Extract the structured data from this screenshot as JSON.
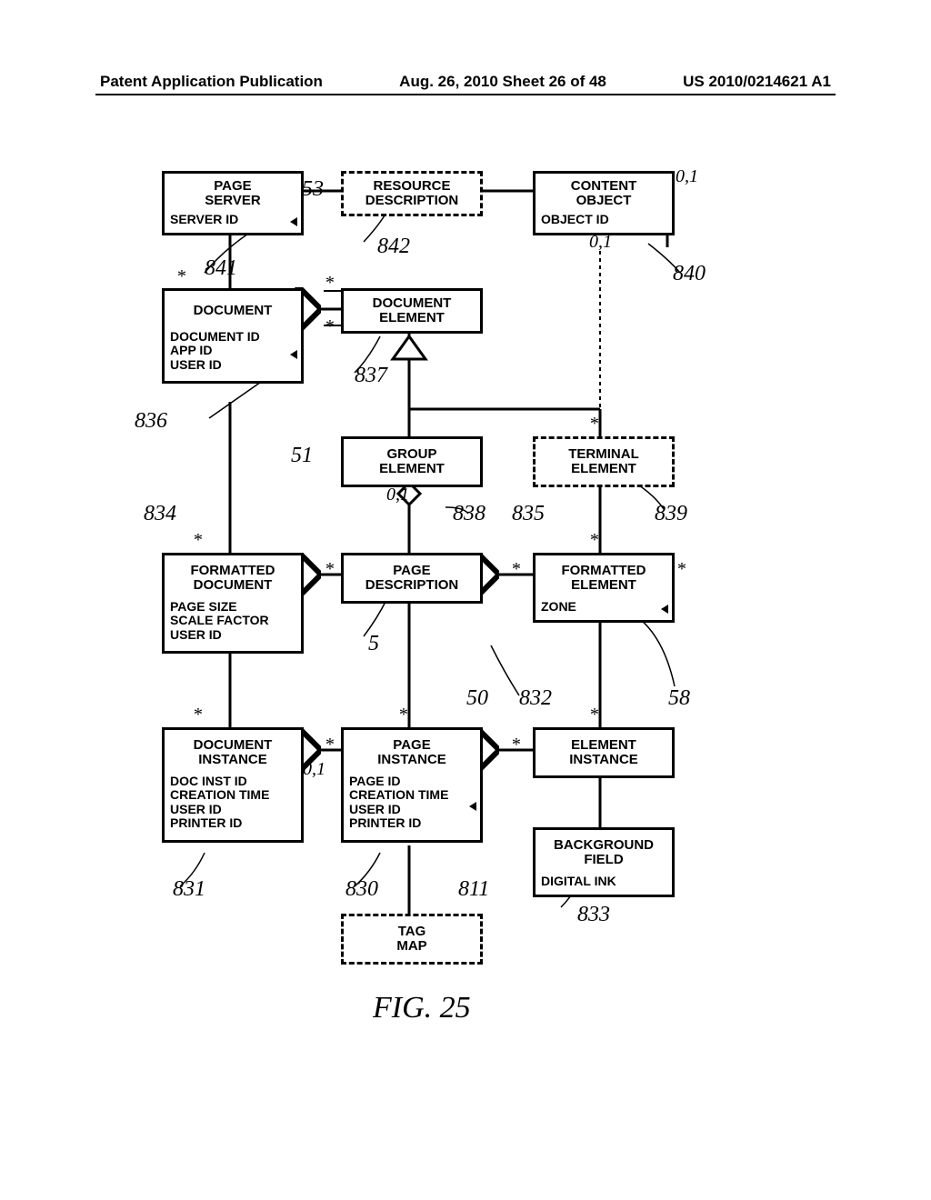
{
  "header": {
    "left": "Patent Application Publication",
    "center": "Aug. 26, 2010  Sheet 26 of 48",
    "right": "US 2010/0214621 A1"
  },
  "boxes": {
    "page_server": "PAGE\nSERVER",
    "page_server_attr": "SERVER ID",
    "resource_desc": "RESOURCE\nDESCRIPTION",
    "content_obj": "CONTENT\nOBJECT",
    "content_obj_attr": "OBJECT ID",
    "document": "DOCUMENT",
    "document_attr": "DOCUMENT ID\nAPP ID\nUSER ID",
    "document_element": "DOCUMENT\nELEMENT",
    "group_element": "GROUP\nELEMENT",
    "terminal_element": "TERMINAL\nELEMENT",
    "formatted_document": "FORMATTED\nDOCUMENT",
    "formatted_document_attr": "PAGE SIZE\nSCALE FACTOR\nUSER ID",
    "page_description": "PAGE\nDESCRIPTION",
    "formatted_element": "FORMATTED\nELEMENT",
    "formatted_element_attr": "ZONE",
    "document_instance": "DOCUMENT\nINSTANCE",
    "document_instance_attr": "DOC INST ID\nCREATION TIME\nUSER ID\nPRINTER ID",
    "page_instance": "PAGE\nINSTANCE",
    "page_instance_attr": "PAGE ID\nCREATION TIME\nUSER ID\nPRINTER ID",
    "element_instance": "ELEMENT\nINSTANCE",
    "background_field": "BACKGROUND\nFIELD",
    "background_field_attr": "DIGITAL INK",
    "tag_map": "TAG\nMAP"
  },
  "refs": {
    "r53": "53",
    "r842": "842",
    "r841": "841",
    "r840": "840",
    "r837": "837",
    "r836": "836",
    "r51": "51",
    "r838": "838",
    "r835": "835",
    "r839": "839",
    "r834": "834",
    "r5": "5",
    "r50": "50",
    "r832": "832",
    "r58": "58",
    "r831": "831",
    "r830": "830",
    "r811": "811",
    "r833": "833"
  },
  "mults": {
    "star": "*",
    "zero_one": "0,1"
  },
  "figure": "FIG. 25"
}
